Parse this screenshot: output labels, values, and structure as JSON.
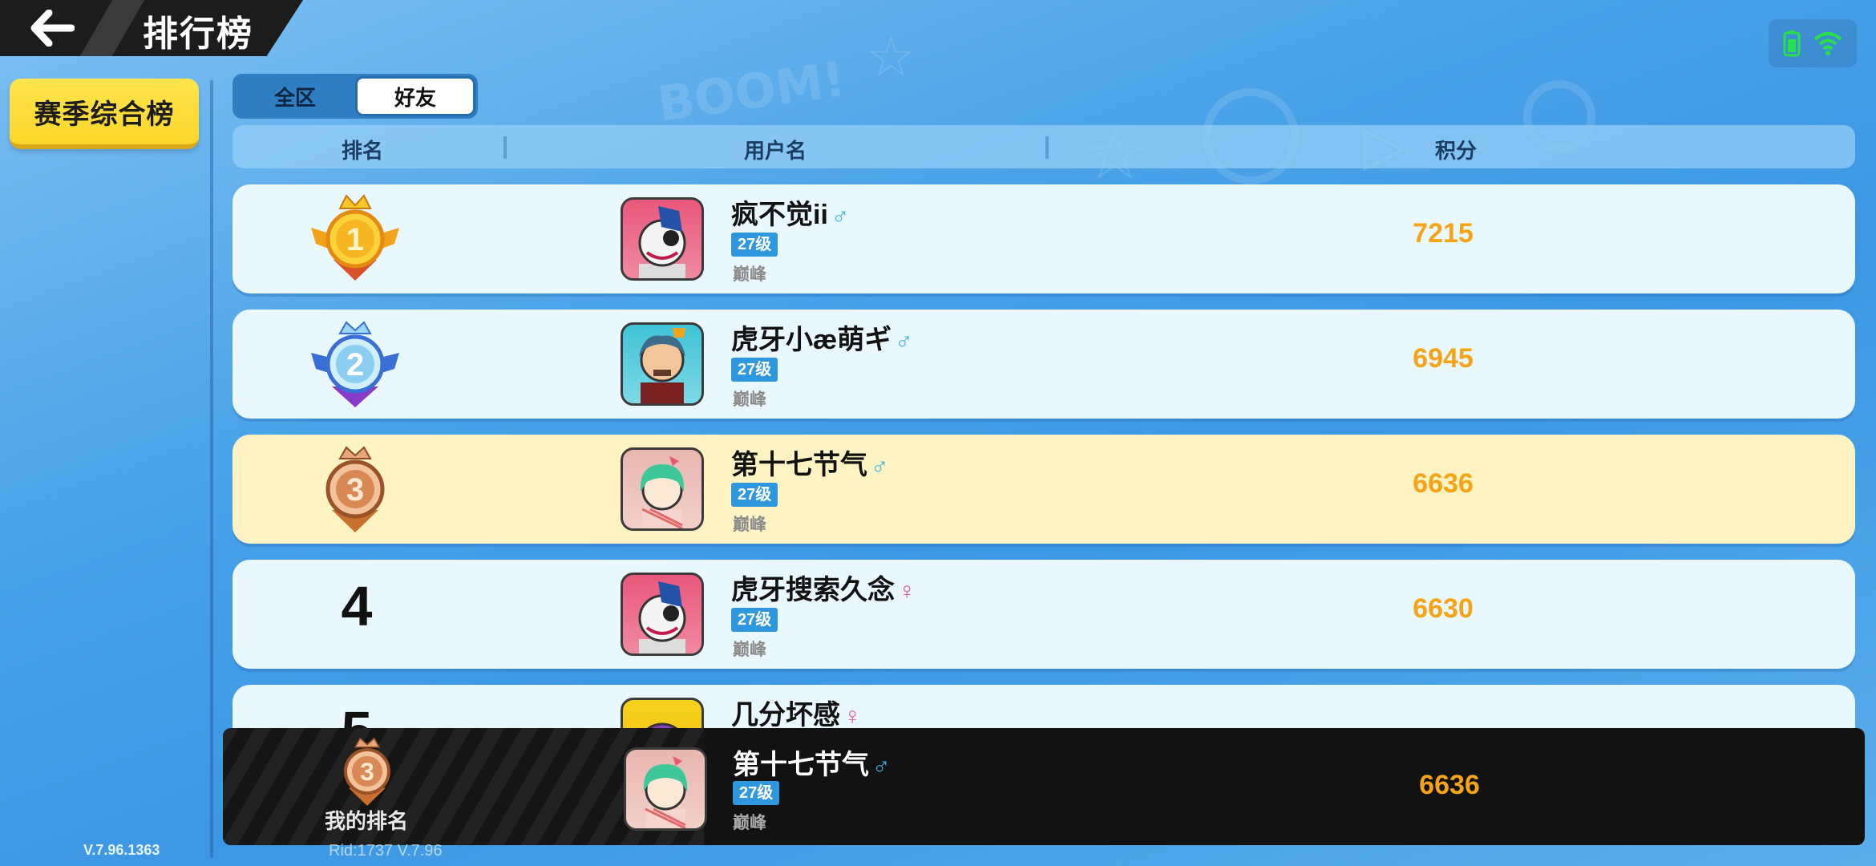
{
  "header": {
    "back_icon": "arrow-left-icon",
    "title": "排行榜"
  },
  "status": {
    "battery_icon": "battery-icon",
    "wifi_icon": "wifi-icon"
  },
  "left_panel": {
    "season_button": "赛季综合榜"
  },
  "tabs": [
    {
      "label": "全区",
      "active": false
    },
    {
      "label": "好友",
      "active": true
    }
  ],
  "columns": {
    "rank": "排名",
    "username": "用户名",
    "score": "积分"
  },
  "rows": [
    {
      "rank": "1",
      "medal": "gold",
      "name": "疯不觉ii",
      "gender": "♂",
      "level": "27级",
      "tier": "巅峰",
      "score": "7215",
      "avatar": "clown-avatar"
    },
    {
      "rank": "2",
      "medal": "silver",
      "name": "虎牙小æ萌ギ",
      "gender": "♂",
      "level": "27级",
      "tier": "巅峰",
      "score": "6945",
      "avatar": "general-avatar"
    },
    {
      "rank": "3",
      "medal": "bronze",
      "name": "第十七节气",
      "gender": "♂",
      "level": "27级",
      "tier": "巅峰",
      "score": "6636",
      "avatar": "girl-avatar",
      "is_me": true
    },
    {
      "rank": "4",
      "medal": "",
      "name": "虎牙搜索久念",
      "gender": "♀",
      "level": "27级",
      "tier": "巅峰",
      "score": "6630",
      "avatar": "clown-avatar"
    },
    {
      "rank": "5",
      "medal": "",
      "name": "几分坏感",
      "gender": "♀",
      "level": "",
      "tier": "",
      "score": "",
      "avatar": "purple-avatar"
    }
  ],
  "my_rank": {
    "label": "我的排名",
    "rank": "3",
    "name": "第十七节气",
    "gender": "♂",
    "level": "27级",
    "tier": "巅峰",
    "score": "6636"
  },
  "footer": {
    "version": "V.7.96.1363",
    "rid": "Rid:1737 V.7.96"
  },
  "colors": {
    "score": "#f6a415",
    "level_badge": "#2f97dd",
    "highlight_row": "#fff3c3",
    "season_button": "#fbd62a"
  }
}
